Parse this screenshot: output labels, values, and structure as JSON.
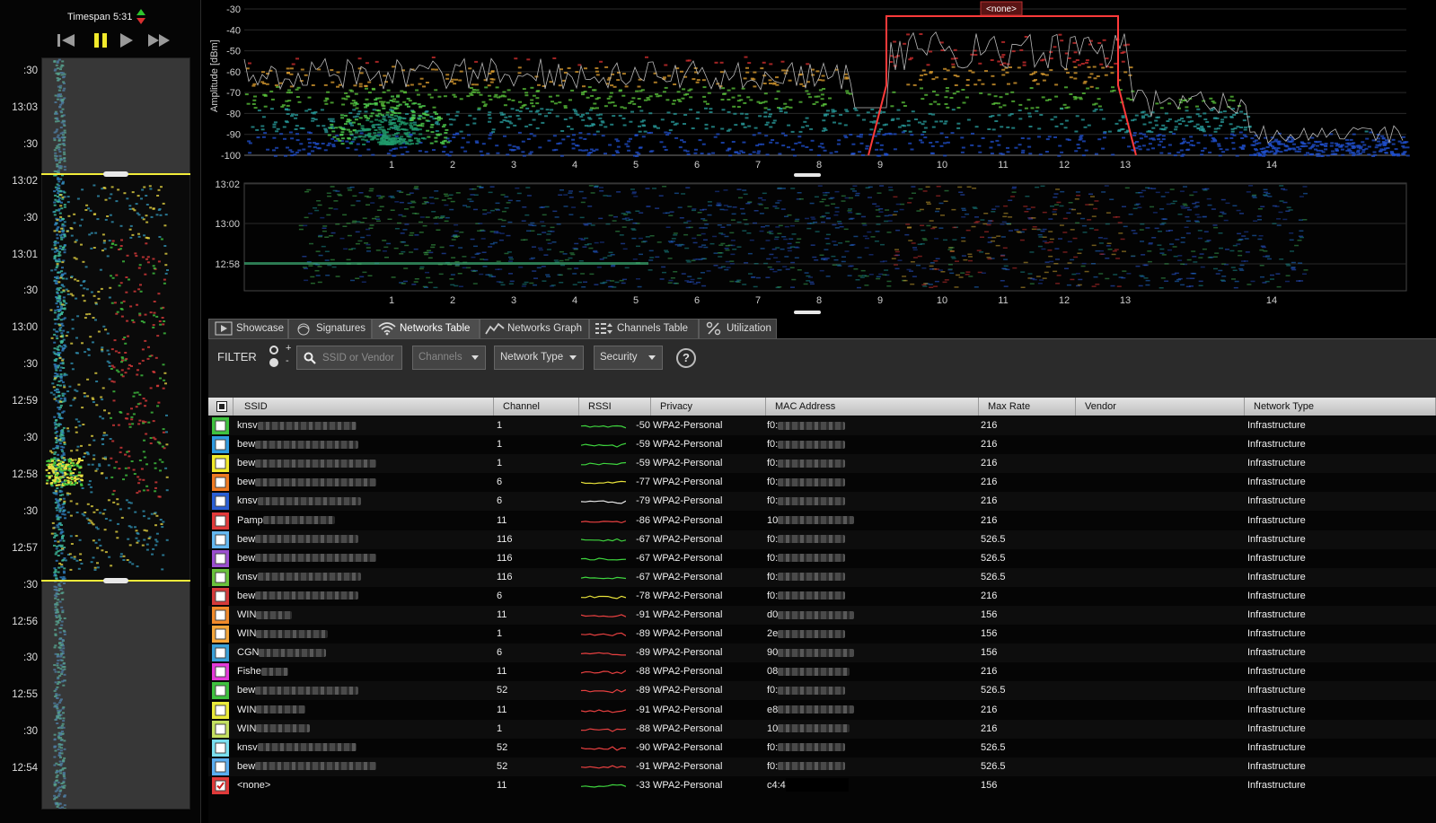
{
  "timeline": {
    "timespan": "Timespan 5:31",
    "labels": [
      ":30",
      "13:03",
      ":30",
      "13:02",
      ":30",
      "13:01",
      ":30",
      "13:00",
      ":30",
      "12:59",
      ":30",
      "12:58",
      ":30",
      "12:57",
      ":30",
      "12:56",
      ":30",
      "12:55",
      ":30",
      "12:54"
    ]
  },
  "spectrum": {
    "ylabel": "Amplitude [dBm]",
    "yticks": [
      "-30",
      "-40",
      "-50",
      "-60",
      "-70",
      "-80",
      "-90",
      "-100"
    ],
    "xticks": [
      "1",
      "2",
      "3",
      "4",
      "5",
      "6",
      "7",
      "8",
      "9",
      "10",
      "11",
      "12",
      "13",
      "14"
    ],
    "selected_label": "<none>"
  },
  "waterfall": {
    "yticks": [
      "13:02",
      "13:00",
      "12:58"
    ],
    "xticks": [
      "1",
      "2",
      "3",
      "4",
      "5",
      "6",
      "7",
      "8",
      "9",
      "10",
      "11",
      "12",
      "13",
      "14"
    ]
  },
  "tabs": [
    {
      "label": "Showcase",
      "icon": "play-icon"
    },
    {
      "label": "Signatures",
      "icon": "signature-icon"
    },
    {
      "label": "Networks Table",
      "icon": "wifi-icon"
    },
    {
      "label": "Networks Graph",
      "icon": "graph-icon"
    },
    {
      "label": "Channels Table",
      "icon": "list-icon"
    },
    {
      "label": "Utilization",
      "icon": "percent-icon"
    }
  ],
  "filter": {
    "label": "FILTER",
    "plus": "+",
    "minus": "-",
    "search_placeholder": "SSID or Vendor",
    "channels": "Channels",
    "network_type": "Network Type",
    "security": "Security",
    "help": "?"
  },
  "table": {
    "headers": [
      "SSID",
      "Channel",
      "RSSI",
      "Privacy",
      "MAC Address",
      "Max Rate",
      "Vendor",
      "Network Type"
    ],
    "rows": [
      {
        "color": "#3fc23f",
        "ssid": "knsv",
        "channel": "1",
        "rssi": "-50",
        "privacy": "WPA2-Personal",
        "mac": "f0:",
        "rate": "216",
        "vendor": "",
        "type": "Infrastructure",
        "spark": "#3fd63f",
        "checked": false
      },
      {
        "color": "#2f9be0",
        "ssid": "bew",
        "channel": "1",
        "rssi": "-59",
        "privacy": "WPA2-Personal",
        "mac": "f0:",
        "rate": "216",
        "vendor": "",
        "type": "Infrastructure",
        "spark": "#3fd63f",
        "checked": false
      },
      {
        "color": "#f2ea2b",
        "ssid": "bew",
        "channel": "1",
        "rssi": "-59",
        "privacy": "WPA2-Personal",
        "mac": "f0:",
        "rate": "216",
        "vendor": "",
        "type": "Infrastructure",
        "spark": "#3fd63f",
        "checked": false
      },
      {
        "color": "#f07a22",
        "ssid": "bew",
        "channel": "6",
        "rssi": "-77",
        "privacy": "WPA2-Personal",
        "mac": "f0:",
        "rate": "216",
        "vendor": "",
        "type": "Infrastructure",
        "spark": "#e8e23a",
        "checked": false
      },
      {
        "color": "#2a5fd6",
        "ssid": "knsv",
        "channel": "6",
        "rssi": "-79",
        "privacy": "WPA2-Personal",
        "mac": "f0:",
        "rate": "216",
        "vendor": "",
        "type": "Infrastructure",
        "spark": "#e8e8e8",
        "checked": false
      },
      {
        "color": "#e13a3a",
        "ssid": "Pamp",
        "channel": "11",
        "rssi": "-86",
        "privacy": "WPA2-Personal",
        "mac": "10",
        "rate": "216",
        "vendor": "",
        "type": "Infrastructure",
        "spark": "#e84040",
        "checked": false
      },
      {
        "color": "#64b8f0",
        "ssid": "bew",
        "channel": "116",
        "rssi": "-67",
        "privacy": "WPA2-Personal",
        "mac": "f0:",
        "rate": "526.5",
        "vendor": "",
        "type": "Infrastructure",
        "spark": "#3fd63f",
        "checked": false
      },
      {
        "color": "#9b4fd0",
        "ssid": "bew",
        "channel": "116",
        "rssi": "-67",
        "privacy": "WPA2-Personal",
        "mac": "f0:",
        "rate": "526.5",
        "vendor": "",
        "type": "Infrastructure",
        "spark": "#3fd63f",
        "checked": false
      },
      {
        "color": "#6ac23c",
        "ssid": "knsv",
        "channel": "116",
        "rssi": "-67",
        "privacy": "WPA2-Personal",
        "mac": "f0:",
        "rate": "526.5",
        "vendor": "",
        "type": "Infrastructure",
        "spark": "#3fd63f",
        "checked": false
      },
      {
        "color": "#d63a3a",
        "ssid": "bew",
        "channel": "6",
        "rssi": "-78",
        "privacy": "WPA2-Personal",
        "mac": "f0:",
        "rate": "216",
        "vendor": "",
        "type": "Infrastructure",
        "spark": "#e8e23a",
        "checked": false
      },
      {
        "color": "#f28a2a",
        "ssid": "WIN",
        "channel": "11",
        "rssi": "-91",
        "privacy": "WPA2-Personal",
        "mac": "d0",
        "rate": "156",
        "vendor": "",
        "type": "Infrastructure",
        "spark": "#e84040",
        "checked": false
      },
      {
        "color": "#f5a63a",
        "ssid": "WIN",
        "channel": "1",
        "rssi": "-89",
        "privacy": "WPA2-Personal",
        "mac": "2e",
        "rate": "156",
        "vendor": "",
        "type": "Infrastructure",
        "spark": "#e84040",
        "checked": false
      },
      {
        "color": "#3aa0d8",
        "ssid": "CGN",
        "channel": "6",
        "rssi": "-89",
        "privacy": "WPA2-Personal",
        "mac": "90",
        "rate": "156",
        "vendor": "",
        "type": "Infrastructure",
        "spark": "#e84040",
        "checked": false
      },
      {
        "color": "#e43ad8",
        "ssid": "Fishe",
        "channel": "11",
        "rssi": "-88",
        "privacy": "WPA2-Personal",
        "mac": "08",
        "rate": "216",
        "vendor": "",
        "type": "Infrastructure",
        "spark": "#e84040",
        "checked": false
      },
      {
        "color": "#3fc23f",
        "ssid": "bew",
        "channel": "52",
        "rssi": "-89",
        "privacy": "WPA2-Personal",
        "mac": "f0:",
        "rate": "526.5",
        "vendor": "",
        "type": "Infrastructure",
        "spark": "#e84040",
        "checked": false
      },
      {
        "color": "#eaea3a",
        "ssid": "WIN",
        "channel": "11",
        "rssi": "-91",
        "privacy": "WPA2-Personal",
        "mac": "e8",
        "rate": "216",
        "vendor": "",
        "type": "Infrastructure",
        "spark": "#e84040",
        "checked": false
      },
      {
        "color": "#c4e060",
        "ssid": "WIN",
        "channel": "1",
        "rssi": "-88",
        "privacy": "WPA2-Personal",
        "mac": "10",
        "rate": "216",
        "vendor": "",
        "type": "Infrastructure",
        "spark": "#e84040",
        "checked": false
      },
      {
        "color": "#7ae0f0",
        "ssid": "knsv",
        "channel": "52",
        "rssi": "-90",
        "privacy": "WPA2-Personal",
        "mac": "f0:",
        "rate": "526.5",
        "vendor": "",
        "type": "Infrastructure",
        "spark": "#e84040",
        "checked": false
      },
      {
        "color": "#5aaef0",
        "ssid": "bew",
        "channel": "52",
        "rssi": "-91",
        "privacy": "WPA2-Personal",
        "mac": "f0:",
        "rate": "526.5",
        "vendor": "",
        "type": "Infrastructure",
        "spark": "#e84040",
        "checked": false
      },
      {
        "color": "#e13a3a",
        "ssid": "<none>",
        "channel": "11",
        "rssi": "-33",
        "privacy": "WPA2-Personal",
        "mac": "c4:4",
        "rate": "156",
        "vendor": "",
        "type": "Infrastructure",
        "spark": "#3fd63f",
        "checked": true
      }
    ]
  }
}
